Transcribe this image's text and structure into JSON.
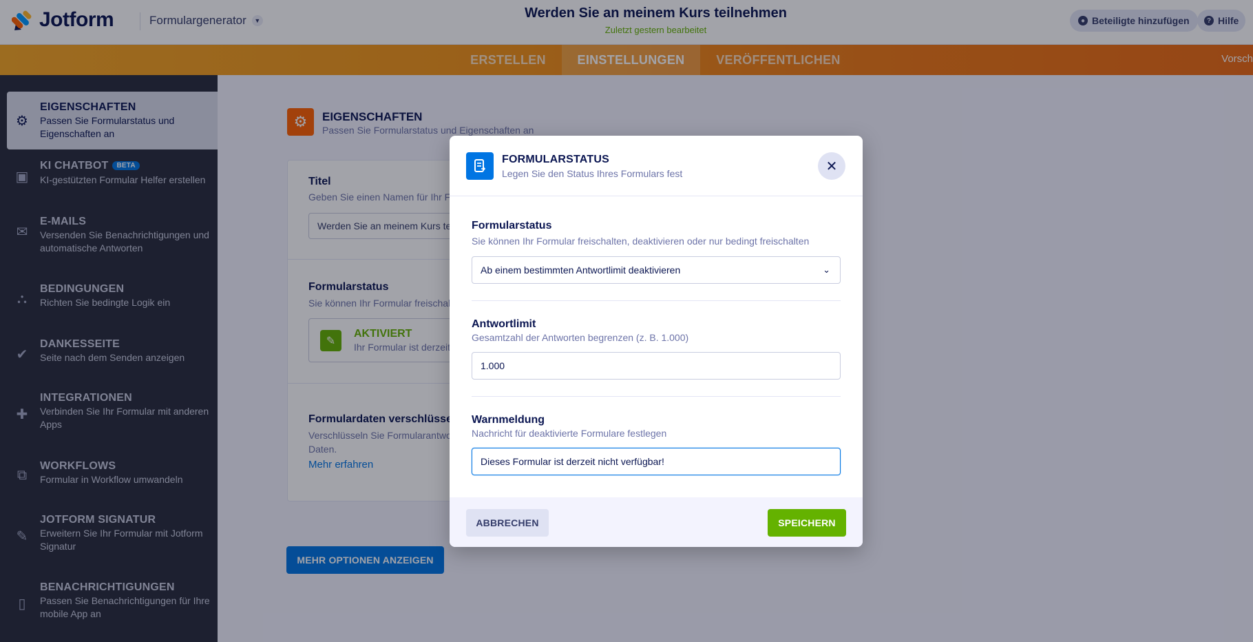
{
  "app": {
    "name": "Jotform",
    "section": "Formulargenerator",
    "form_title": "Werden Sie an meinem Kurs teilnehmen",
    "last_edited": "Zuletzt gestern bearbeitet",
    "add_participants": "Beteiligte hinzufügen",
    "help": "Hilfe"
  },
  "nav": {
    "tabs": [
      "ERSTELLEN",
      "EINSTELLUNGEN",
      "VERÖFFENTLICHEN"
    ],
    "active_tab": "EINSTELLUNGEN",
    "preview": "Vorsch"
  },
  "sidebar": {
    "items": [
      {
        "title": "EIGENSCHAFTEN",
        "desc": "Passen Sie Formularstatus und Eigenschaften an",
        "icon": "gear-icon",
        "active": true
      },
      {
        "title": "KI CHATBOT",
        "badge": "BETA",
        "desc": "KI-gestützten Formular Helfer erstellen",
        "icon": "chatbot-icon"
      },
      {
        "title": "E-MAILS",
        "desc": "Versenden Sie Benachrichtigungen und automatische Antworten",
        "icon": "envelope-icon"
      },
      {
        "title": "BEDINGUNGEN",
        "desc": "Richten Sie bedingte Logik ein",
        "icon": "sitemap-icon"
      },
      {
        "title": "DANKESSEITE",
        "desc": "Seite nach dem Senden anzeigen",
        "icon": "check-circle-icon"
      },
      {
        "title": "INTEGRATIONEN",
        "desc": "Verbinden Sie Ihr Formular mit anderen Apps",
        "icon": "puzzle-icon"
      },
      {
        "title": "WORKFLOWS",
        "desc": "Formular in Workflow umwandeln",
        "icon": "workflow-icon"
      },
      {
        "title": "JOTFORM SIGNATUR",
        "desc": "Erweitern Sie Ihr Formular mit Jotform Signatur",
        "icon": "pen-icon"
      },
      {
        "title": "BENACHRICHTIGUNGEN",
        "desc": "Passen Sie Benachrichtigungen für Ihre mobile App an",
        "icon": "mobile-icon"
      }
    ]
  },
  "main": {
    "title": "EIGENSCHAFTEN",
    "subtitle": "Passen Sie Formularstatus und Eigenschaften an",
    "titel_label": "Titel",
    "titel_sub": "Geben Sie einen Namen für Ihr Fo",
    "titel_value": "Werden Sie an meinem Kurs te",
    "status_label": "Formularstatus",
    "status_sub": "Sie können Ihr Formular freischal",
    "status_value": "AKTIVIERT",
    "status_desc": "Ihr Formular ist derzeit",
    "encrypt_label": "Formulardaten verschlüssel",
    "encrypt_desc_1": "Verschlüsseln Sie Formularantwo",
    "encrypt_desc_2": "Daten.",
    "learn_more": "Mehr erfahren",
    "more_options": "MEHR OPTIONEN ANZEIGEN"
  },
  "modal": {
    "title": "FORMULARSTATUS",
    "subtitle": "Legen Sie den Status Ihres Formulars fest",
    "status_label": "Formularstatus",
    "status_sub": "Sie können Ihr Formular freischalten, deaktivieren oder nur bedingt freischalten",
    "status_selected": "Ab einem bestimmten Antwortlimit deaktivieren",
    "limit_label": "Antwortlimit",
    "limit_sub": "Gesamtzahl der Antworten begrenzen (z. B. 1.000)",
    "limit_value": "1.000",
    "warning_label": "Warnmeldung",
    "warning_sub": "Nachricht für deaktivierte Formulare festlegen",
    "warning_value": "Dieses Formular ist derzeit nicht verfügbar!",
    "cancel": "ABBRECHEN",
    "save": "SPEICHERN"
  },
  "colors": {
    "brand_orange": "#ff6100",
    "primary_blue": "#0075e3",
    "success_green": "#64b200",
    "sidebar_bg": "#292d3c",
    "navy": "#0a1551"
  }
}
